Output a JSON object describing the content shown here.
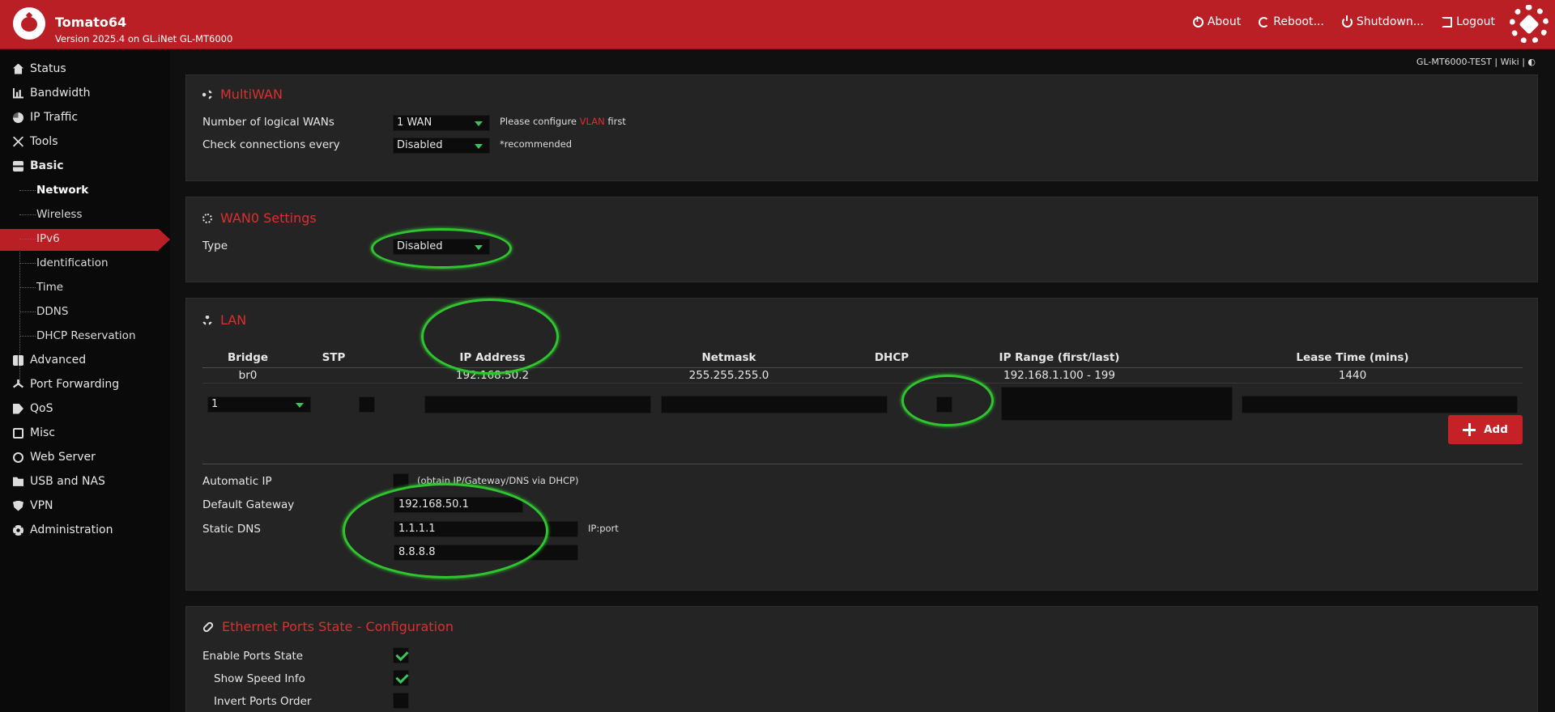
{
  "header": {
    "brand": "Tomato64",
    "version": "Version 2025.4 on GL.iNet GL-MT6000",
    "nav": [
      {
        "label": "About",
        "icon": "info-icon"
      },
      {
        "label": "Reboot...",
        "icon": "reboot-icon"
      },
      {
        "label": "Shutdown...",
        "icon": "power-icon"
      },
      {
        "label": "Logout",
        "icon": "logout-icon"
      }
    ]
  },
  "hostline": "GL-MT6000-TEST | Wiki | ◐",
  "sidebar": {
    "items": [
      {
        "label": "Status",
        "icon": "home-icon"
      },
      {
        "label": "Bandwidth",
        "icon": "chart-icon"
      },
      {
        "label": "IP Traffic",
        "icon": "pie-icon"
      },
      {
        "label": "Tools",
        "icon": "tools-icon"
      },
      {
        "label": "Basic",
        "icon": "server-icon"
      },
      {
        "label": "Advanced",
        "icon": "advanced-icon"
      },
      {
        "label": "Port Forwarding",
        "icon": "fork-icon"
      },
      {
        "label": "QoS",
        "icon": "tag-icon"
      },
      {
        "label": "Misc",
        "icon": "cast-icon"
      },
      {
        "label": "Web Server",
        "icon": "globe-icon"
      },
      {
        "label": "USB and NAS",
        "icon": "folder-icon"
      },
      {
        "label": "VPN",
        "icon": "shield-icon"
      },
      {
        "label": "Administration",
        "icon": "gear-icon"
      }
    ],
    "basic_sub": [
      "Network",
      "Wireless",
      "IPv6",
      "Identification",
      "Time",
      "DDNS",
      "DHCP Reservation"
    ]
  },
  "multiwan": {
    "title": "MultiWAN",
    "wans_label": "Number of logical WANs",
    "wans_value": "1 WAN",
    "wans_note_pre": "Please configure ",
    "wans_note_link": "VLAN",
    "wans_note_post": " first",
    "check_label": "Check connections every",
    "check_value": "Disabled",
    "check_note": "*recommended"
  },
  "wan0": {
    "title": "WAN0 Settings",
    "type_label": "Type",
    "type_value": "Disabled"
  },
  "lan": {
    "title": "LAN",
    "headers": [
      "Bridge",
      "STP",
      "IP Address",
      "Netmask",
      "DHCP",
      "IP Range (first/last)",
      "Lease Time (mins)"
    ],
    "row": [
      "br0",
      "",
      "192.168.50.2",
      "255.255.255.0",
      "",
      "192.168.1.100 - 199",
      "1440"
    ],
    "new_bridge_value": "1",
    "add_label": "Add",
    "auto_ip_label": "Automatic IP",
    "auto_ip_note": "(obtain IP/Gateway/DNS via DHCP)",
    "gateway_label": "Default Gateway",
    "gateway_value": "192.168.50.1",
    "dns_label": "Static DNS",
    "dns1": "1.1.1.1",
    "dns2": "8.8.8.8",
    "dns_note": "IP:port"
  },
  "ethports": {
    "title": "Ethernet Ports State - Configuration",
    "enable_label": "Enable Ports State",
    "speed_label": "Show Speed Info",
    "invert_label": "Invert Ports Order"
  },
  "colors": {
    "accent": "#b91f25",
    "title_red": "#d9302f",
    "check_green": "#3ec25a",
    "highlight_green": "#2fc52f"
  }
}
